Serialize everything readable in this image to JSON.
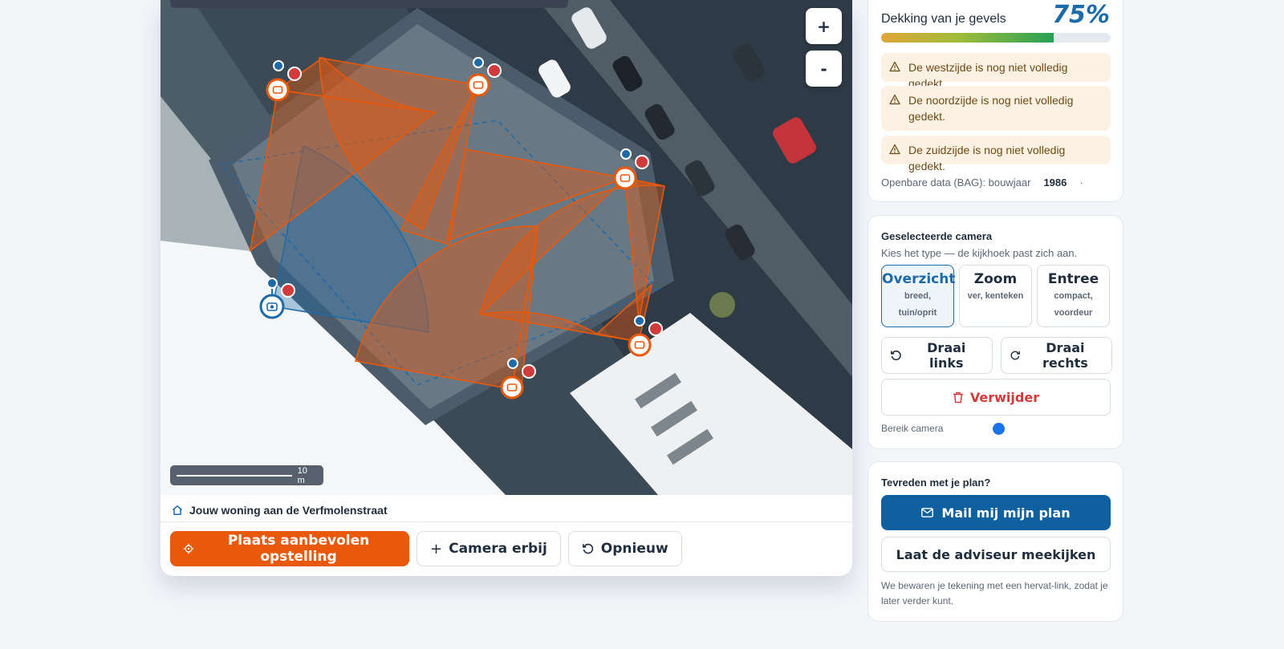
{
  "map": {
    "zoom_in": "+",
    "zoom_out": "-",
    "scale_label": "10 m",
    "address_label": "Jouw woning aan de Verfmolenstraat",
    "colors": {
      "fov_orange": "#e8590c",
      "fov_blue": "#1c6aa8",
      "remove_red": "#d23b3b"
    }
  },
  "actions": {
    "place_recommended": "Plaats aanbevolen opstelling",
    "add_camera": "Camera erbij",
    "reset": "Opnieuw"
  },
  "coverage": {
    "title": "Dekking van je gevels",
    "percent_label": "75%",
    "percent": 75,
    "warnings": [
      "De westzijde is nog niet volledig gedekt.",
      "De noordzijde is nog niet volledig gedekt.",
      "De zuidzijde is nog niet volledig gedekt."
    ],
    "bag_label": "Openbare data (BAG): bouwjaar",
    "bag_year": "1986",
    "bag_dot": "·"
  },
  "camera": {
    "title": "Geselecteerde camera",
    "subtitle": "Kies het type — de kijkhoek past zich aan.",
    "types": [
      {
        "name": "Overzicht",
        "desc1": "breed,",
        "desc2": "tuin/oprit",
        "selected": true
      },
      {
        "name": "Zoom",
        "desc1": "ver, kenteken",
        "desc2": "",
        "selected": false
      },
      {
        "name": "Entree",
        "desc1": "compact,",
        "desc2": "voordeur",
        "selected": false
      }
    ],
    "rotate_left": "Draai links",
    "rotate_right": "Draai rechts",
    "delete": "Verwijder",
    "range_label": "Bereik camera"
  },
  "plan": {
    "title": "Tevreden met je plan?",
    "mail": "Mail mij mijn plan",
    "advisor": "Laat de adviseur meekijken",
    "note": "We bewaren je tekening met een hervat-link, zodat je later verder kunt."
  }
}
